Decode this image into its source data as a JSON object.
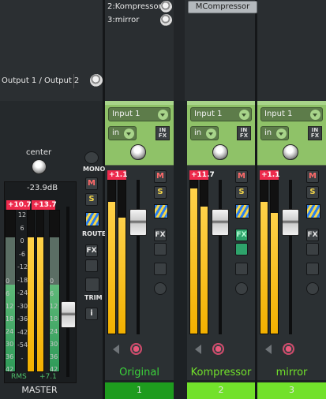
{
  "top": {
    "sends": [
      {
        "label": "2:Kompressor"
      },
      {
        "label": "3:mirror"
      }
    ],
    "plugin_button": "MCompressor",
    "output_label": "Output 1 / Output 2"
  },
  "master": {
    "pan_label": "center",
    "volume_readout": "-23.9dB",
    "peak_left": "+10.7",
    "peak_right": "+13.7",
    "scale": [
      "12",
      "6",
      "0",
      "-6",
      "-12",
      "-18",
      "-24",
      "-30",
      "-36",
      "-42",
      "-54",
      "-"
    ],
    "scale_right": [
      "12",
      "6",
      "0",
      "-6",
      "-12",
      "-18",
      "-24",
      "-30",
      "-36",
      "-42",
      "-54",
      "-"
    ],
    "scale_left_side": [
      "0",
      "6",
      "12",
      "18",
      "24",
      "30",
      "36",
      "42"
    ],
    "rms_label": "RMS",
    "rms_value": "+7.1",
    "name": "MASTER",
    "buttons": {
      "mono": "MONO",
      "mute": "M",
      "solo": "S",
      "route": "ROUTE",
      "fx": "FX",
      "trim": "TRIM",
      "info": "i"
    }
  },
  "tracks": [
    {
      "input": "Input 1",
      "mode": "in",
      "infx": "IN FX",
      "peak": "+1.1",
      "mute": "M",
      "solo": "S",
      "fx": "FX",
      "fx_active": false,
      "name": "Original",
      "number": "1",
      "meter_levels": [
        0.85,
        0.75
      ],
      "accent": "#1e9c1e",
      "name_color": "#3bd23b"
    },
    {
      "input": "Input 1",
      "mode": "in",
      "infx": "IN FX",
      "peak": "+11.7",
      "mute": "M",
      "solo": "S",
      "fx": "FX",
      "fx_active": true,
      "name": "Kompressor",
      "number": "2",
      "meter_levels": [
        0.94,
        0.82
      ],
      "accent": "#72e12b",
      "name_color": "#72e12b"
    },
    {
      "input": "Input 1",
      "mode": "in",
      "infx": "IN FX",
      "peak": "+1.1",
      "mute": "M",
      "solo": "S",
      "fx": "FX",
      "fx_active": false,
      "name": "mirror",
      "number": "3",
      "meter_levels": [
        0.85,
        0.78
      ],
      "accent": "#72e12b",
      "name_color": "#72e12b"
    }
  ],
  "colors": {
    "mute": "#ff6a6a",
    "solo": "#f2d54a",
    "peak": "#ee2a4c",
    "meter": "#f2b000",
    "track_panel": "#8fc268"
  }
}
